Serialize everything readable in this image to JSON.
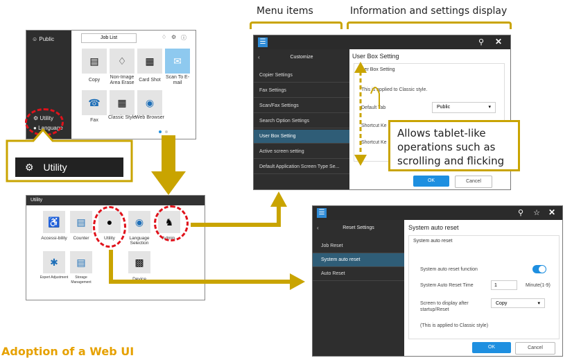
{
  "labels": {
    "menu_items": "Menu items",
    "info_settings": "Information and settings display",
    "tablet_ops": "Allows tablet-like operations such as scrolling and flicking",
    "caption": "Adoption of a Web UI"
  },
  "screen1": {
    "public": "Public",
    "job_list": "Job List",
    "side_utility": "Utility",
    "side_language": "Language",
    "tiles": [
      "Copy",
      "Non-Image Area Erase",
      "Card Shot",
      "Scan To E-mail",
      "Fax",
      "Classic Style",
      "Web Browser"
    ]
  },
  "utility_callout": "Utility",
  "screen2": {
    "title": "Utility",
    "tiles": [
      "Accessi-bility",
      "Counter",
      "Utility",
      "Language Selection",
      "Admin.",
      "Expert Adjustment",
      "Storage Management",
      "Device"
    ]
  },
  "screen3": {
    "side_title": "Customize",
    "menu": [
      "Copier Settings",
      "Fax Settings",
      "Scan/Fax Settings",
      "Search Option Settings",
      "User Box Setting",
      "Active screen setting",
      "Default Application Screen Type Se..."
    ],
    "selected_index": 4,
    "panel_title": "User Box Setting",
    "section": "User Box Setting",
    "note": "This is applied to Classic style.",
    "default_tab_label": "Default Tab",
    "default_tab_value": "Public",
    "shortcut1": "Shortcut Ke",
    "shortcut2": "Shortcut Ke",
    "ok": "OK",
    "cancel": "Cancel"
  },
  "screen4": {
    "side_title": "Reset Settings",
    "menu": [
      "Job Reset",
      "System auto reset",
      "Auto Reset"
    ],
    "selected_index": 1,
    "panel_title": "System auto reset",
    "section": "System auto reset",
    "fields": {
      "function_label": "System auto reset function",
      "time_label": "System Auto Reset Time",
      "time_value": "1",
      "time_unit": "Minute(1-9)",
      "screen_label": "Screen to display after startup/Reset",
      "screen_value": "Copy",
      "note": "(This is applied to Classic style)"
    },
    "ok": "OK",
    "cancel": "Cancel"
  },
  "colors": {
    "accent_gold": "#c9a400",
    "highlight_red": "#e0121b",
    "ui_blue": "#1e8fe0",
    "selected_row": "#2f5d77"
  }
}
